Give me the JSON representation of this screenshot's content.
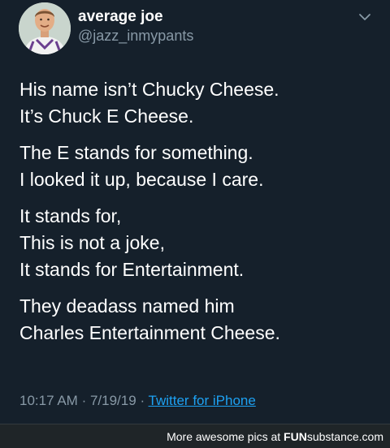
{
  "tweet": {
    "author": {
      "display_name": "average joe",
      "handle": "@jazz_inmypants"
    },
    "paragraphs": [
      [
        "His name isn’t Chucky Cheese.",
        "It’s Chuck E Cheese."
      ],
      [
        "The E stands for something.",
        "I looked it up, because I care."
      ],
      [
        "It stands for,",
        "This is not a joke,",
        "It stands for Entertainment."
      ],
      [
        "They deadass named him",
        "Charles Entertainment Cheese."
      ]
    ],
    "time": "10:17 AM",
    "date": "7/19/19",
    "separator": "·",
    "source": "Twitter for iPhone",
    "menu_icon": "chevron-down-icon"
  },
  "footer": {
    "prefix": "More awesome pics at",
    "brand_bold": "FUN",
    "brand_rest": "substance.com"
  },
  "colors": {
    "background": "#15202b",
    "secondary_text": "#8899a6",
    "link": "#1da1f2",
    "footer_background": "#1f2528"
  }
}
